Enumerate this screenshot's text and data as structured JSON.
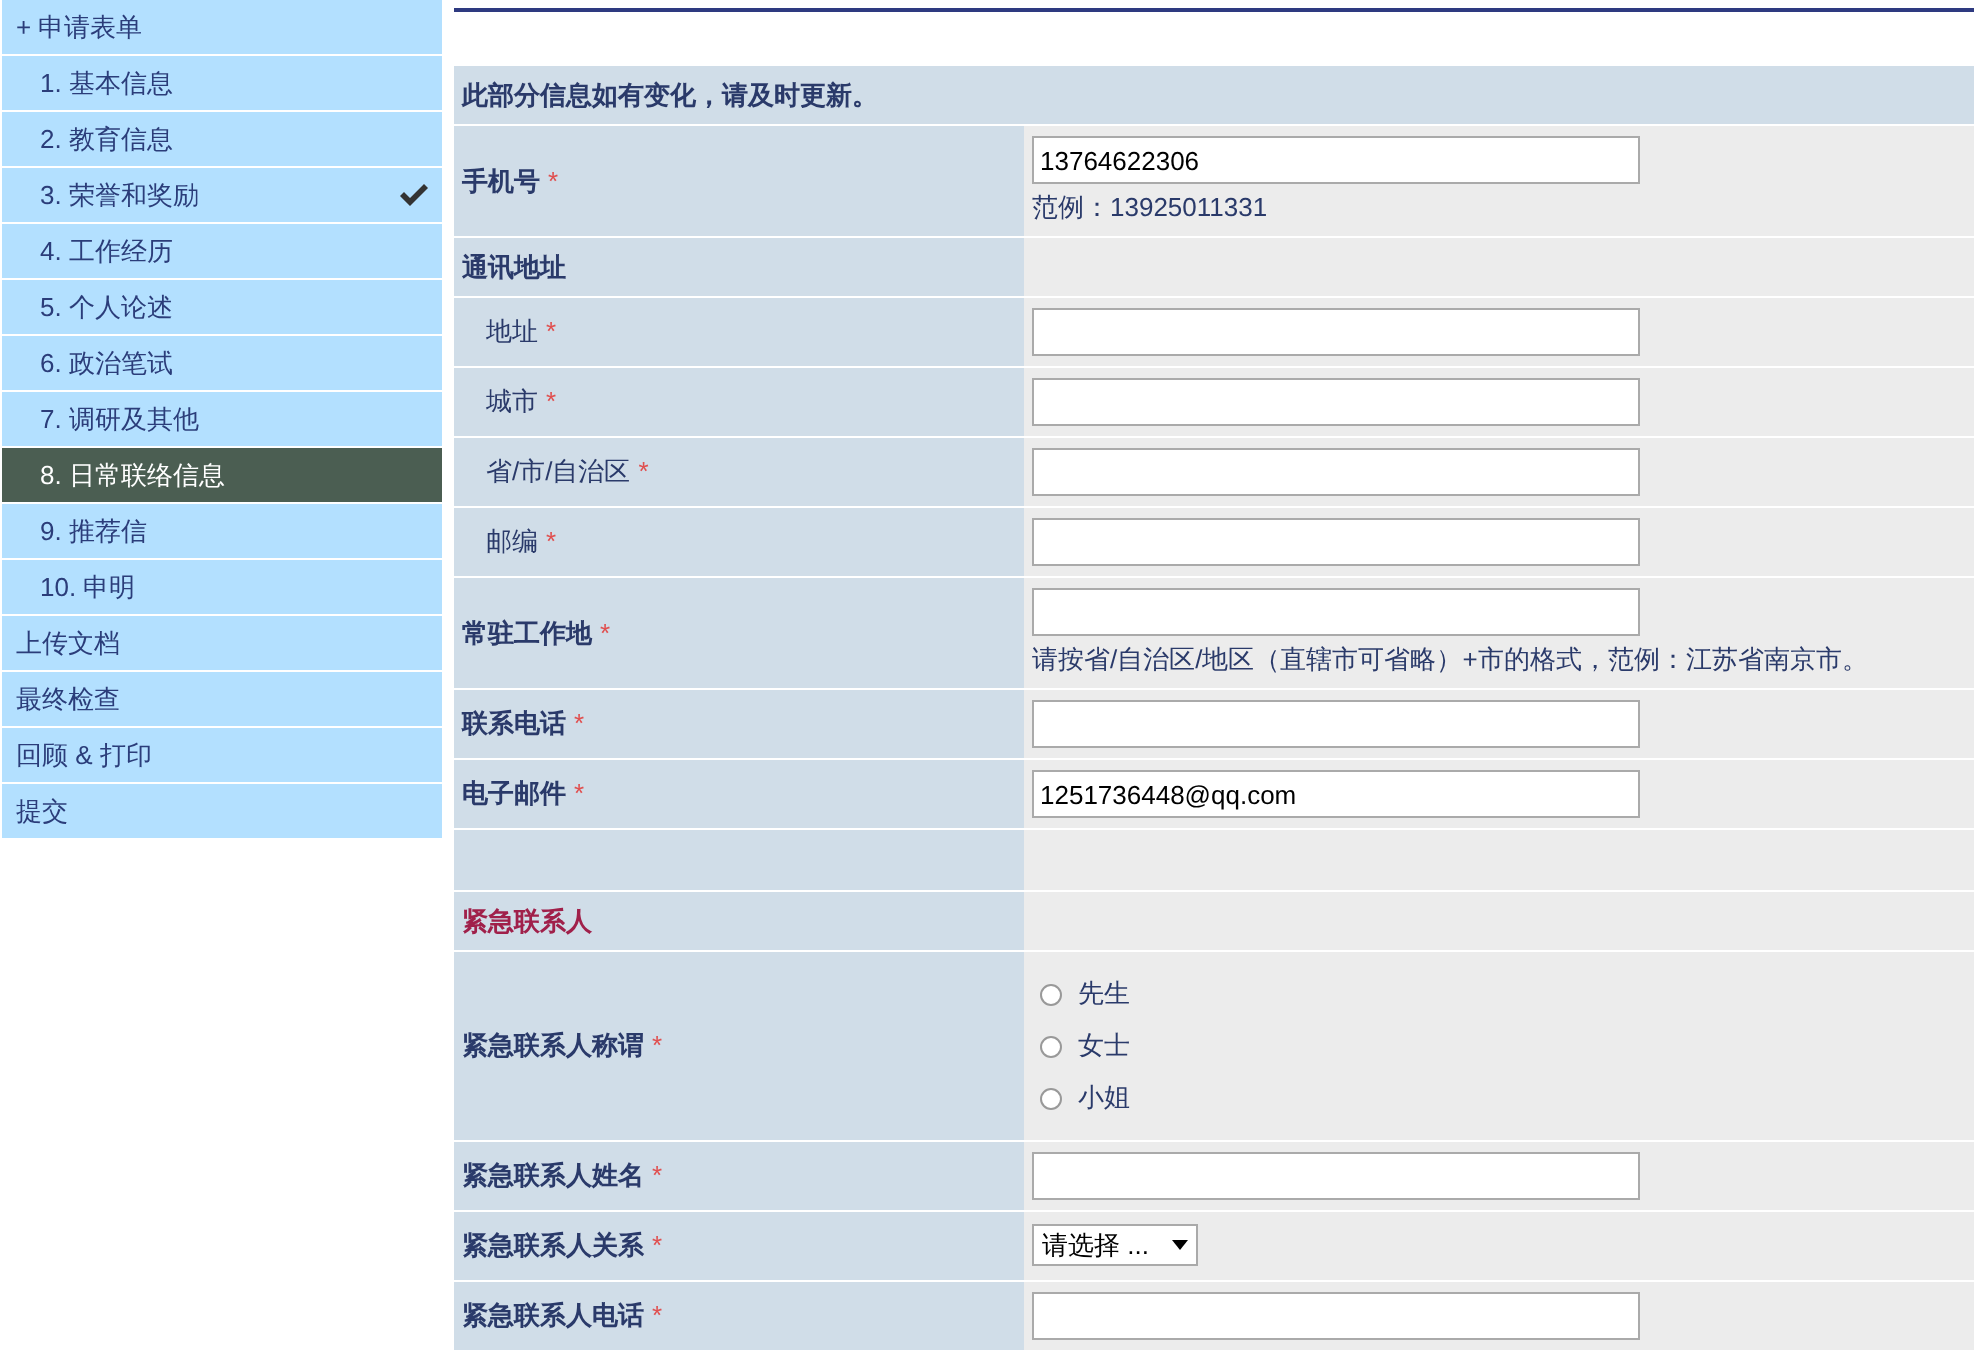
{
  "sidebar": {
    "items": [
      {
        "label": "+ 申请表单",
        "selected": false,
        "children": [
          {
            "label": "1. 基本信息",
            "selected": false,
            "completed": false
          },
          {
            "label": "2. 教育信息",
            "selected": false,
            "completed": false
          },
          {
            "label": "3. 荣誉和奖励",
            "selected": false,
            "completed": true
          },
          {
            "label": "4. 工作经历",
            "selected": false,
            "completed": false
          },
          {
            "label": "5. 个人论述",
            "selected": false,
            "completed": false
          },
          {
            "label": "6. 政治笔试",
            "selected": false,
            "completed": false
          },
          {
            "label": "7. 调研及其他",
            "selected": false,
            "completed": false
          },
          {
            "label": "8. 日常联络信息",
            "selected": true,
            "completed": false
          },
          {
            "label": "9. 推荐信",
            "selected": false,
            "completed": false
          },
          {
            "label": "10. 申明",
            "selected": false,
            "completed": false
          }
        ]
      },
      {
        "label": "上传文档",
        "selected": false
      },
      {
        "label": "最终检查",
        "selected": false
      },
      {
        "label": "回顾 & 打印",
        "selected": false
      },
      {
        "label": "提交",
        "selected": false
      }
    ]
  },
  "form": {
    "notice": "此部分信息如有变化，请及时更新。",
    "rows": [
      {
        "kind": "input",
        "label": "手机号",
        "mark": "*",
        "value": "13764622306",
        "hint": "范例：13925011331"
      },
      {
        "kind": "heading",
        "label": "通讯地址",
        "highlight": false,
        "children": [
          {
            "kind": "input",
            "label": "地址",
            "mark": "*"
          },
          {
            "kind": "input",
            "label": "城市",
            "mark": "*"
          },
          {
            "kind": "input",
            "label": "省/市/自治区",
            "mark": "*"
          },
          {
            "kind": "input",
            "label": "邮编",
            "mark": "*"
          }
        ]
      },
      {
        "kind": "input",
        "label": "常驻工作地",
        "mark": "*",
        "hint": "请按省/自治区/地区（直辖市可省略）+市的格式，范例：江苏省南京市。"
      },
      {
        "kind": "input",
        "label": "联系电话",
        "mark": "*"
      },
      {
        "kind": "input",
        "label": "电子邮件",
        "mark": "*",
        "value": "1251736448@qq.com"
      },
      {
        "kind": "blank"
      },
      {
        "kind": "heading",
        "label": "紧急联系人",
        "highlight": true
      },
      {
        "kind": "radio",
        "label": "紧急联系人称谓",
        "mark": "*",
        "options": [
          {
            "label": "先生",
            "selected": false
          },
          {
            "label": "女士",
            "selected": false
          },
          {
            "label": "小姐",
            "selected": false
          }
        ]
      },
      {
        "kind": "input",
        "label": "紧急联系人姓名",
        "mark": "*"
      },
      {
        "kind": "select",
        "label": "紧急联系人关系",
        "mark": "*",
        "value": "请选择 ..."
      },
      {
        "kind": "input",
        "label": "紧急联系人电话",
        "mark": "*"
      }
    ]
  }
}
